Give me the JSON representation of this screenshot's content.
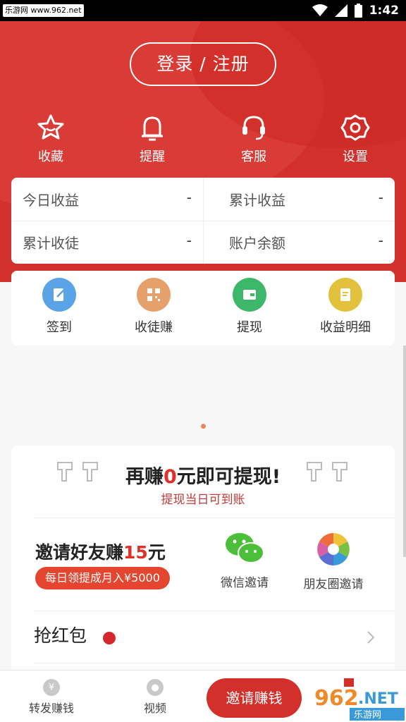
{
  "status_bar": {
    "watermark": "乐游网 www.962.net",
    "time": "1:42"
  },
  "header": {
    "login_label": "登录 / 注册",
    "quick_actions": [
      {
        "label": "收藏",
        "icon": "star-icon"
      },
      {
        "label": "提醒",
        "icon": "bell-icon"
      },
      {
        "label": "客服",
        "icon": "headset-icon"
      },
      {
        "label": "设置",
        "icon": "gear-icon"
      }
    ]
  },
  "stats": {
    "today_income": {
      "label": "今日收益",
      "value": "-"
    },
    "total_income": {
      "label": "累计收益",
      "value": "-"
    },
    "total_disciples": {
      "label": "累计收徒",
      "value": "-"
    },
    "balance": {
      "label": "账户余额",
      "value": "-"
    }
  },
  "functions": [
    {
      "label": "签到",
      "icon": "checkin-icon",
      "color": "#5aa3e6"
    },
    {
      "label": "收徒赚",
      "icon": "qrcode-icon",
      "color": "#e6a06a"
    },
    {
      "label": "提现",
      "icon": "wallet-icon",
      "color": "#3db86b"
    },
    {
      "label": "收益明细",
      "icon": "bill-icon",
      "color": "#e2c23c"
    }
  ],
  "earn": {
    "title_pre": "再赚",
    "title_num": "0",
    "title_post": "元即可提现!",
    "subtitle": "提现当日可到账",
    "invite_pre": "邀请好友赚",
    "invite_num": "15",
    "invite_post": "元",
    "invite_badge": "每日领提成月入¥5000",
    "wechat_label": "微信邀请",
    "moments_label": "朋友圈邀请",
    "hongbao_label": "抢红包"
  },
  "tabbar": {
    "forward_label": "转发赚钱",
    "video_label": "视频",
    "invite_label": "邀请赚钱"
  },
  "colors": {
    "brand_red": "#d3302b",
    "accent_orange": "#e3452f"
  }
}
